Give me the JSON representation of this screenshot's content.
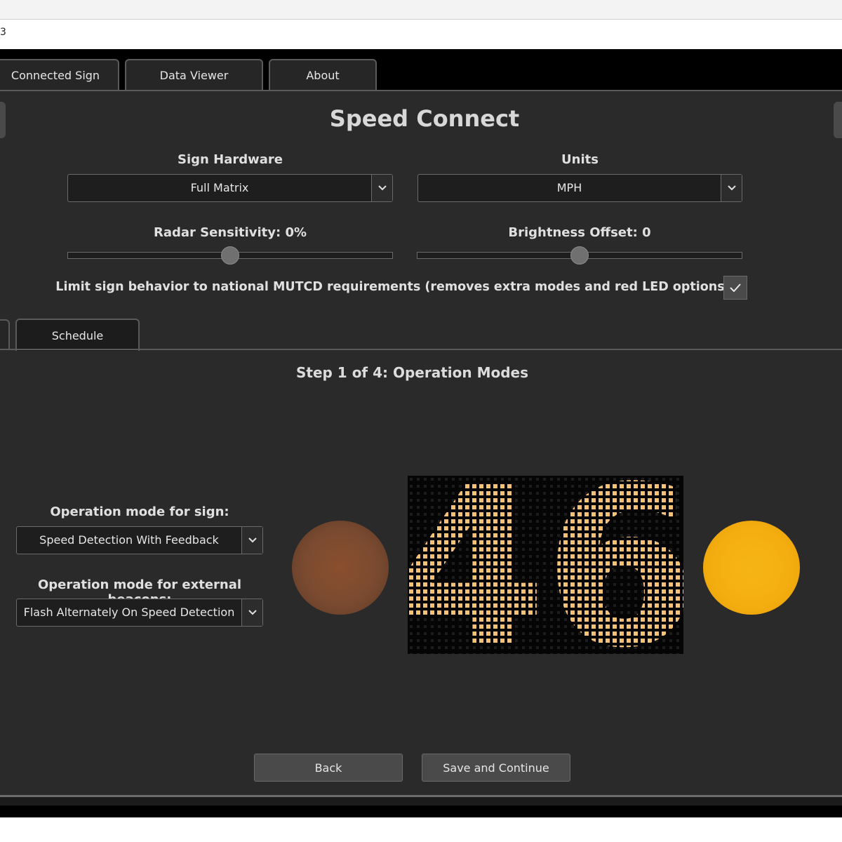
{
  "window": {
    "title": "3"
  },
  "tabs": [
    {
      "label": "Connected Sign"
    },
    {
      "label": "Data Viewer"
    },
    {
      "label": "About"
    }
  ],
  "app": {
    "title": "Speed Connect"
  },
  "sign_hardware": {
    "label": "Sign Hardware",
    "value": "Full Matrix"
  },
  "units": {
    "label": "Units",
    "value": "MPH"
  },
  "radar_sensitivity": {
    "label": "Radar Sensitivity: 0%",
    "level": 0.5
  },
  "brightness_offset": {
    "label": "Brightness Offset: 0",
    "level": 0.5
  },
  "mutcd": {
    "label": "Limit sign behavior to national MUTCD requirements (removes extra modes and red LED options)",
    "checked": true
  },
  "subtabs": [
    {
      "label": "Schedule"
    }
  ],
  "step": {
    "title": "Step 1 of 4: Operation Modes"
  },
  "operation_mode_sign": {
    "label": "Operation mode for sign:",
    "value": "Speed Detection With Feedback"
  },
  "operation_mode_beacons": {
    "label": "Operation mode for external beacons:",
    "value": "Flash Alternately On Speed Detection"
  },
  "preview": {
    "speed_text": "46",
    "led_color": "#f5c27a",
    "left_beacon": {
      "state": "off",
      "color": "#7a4a30"
    },
    "right_beacon": {
      "state": "on",
      "color": "#f4ad0f"
    }
  },
  "buttons": {
    "back": "Back",
    "save_continue": "Save and Continue"
  },
  "icons": {
    "dropdown": "chevron-down-icon",
    "check": "check-icon"
  }
}
